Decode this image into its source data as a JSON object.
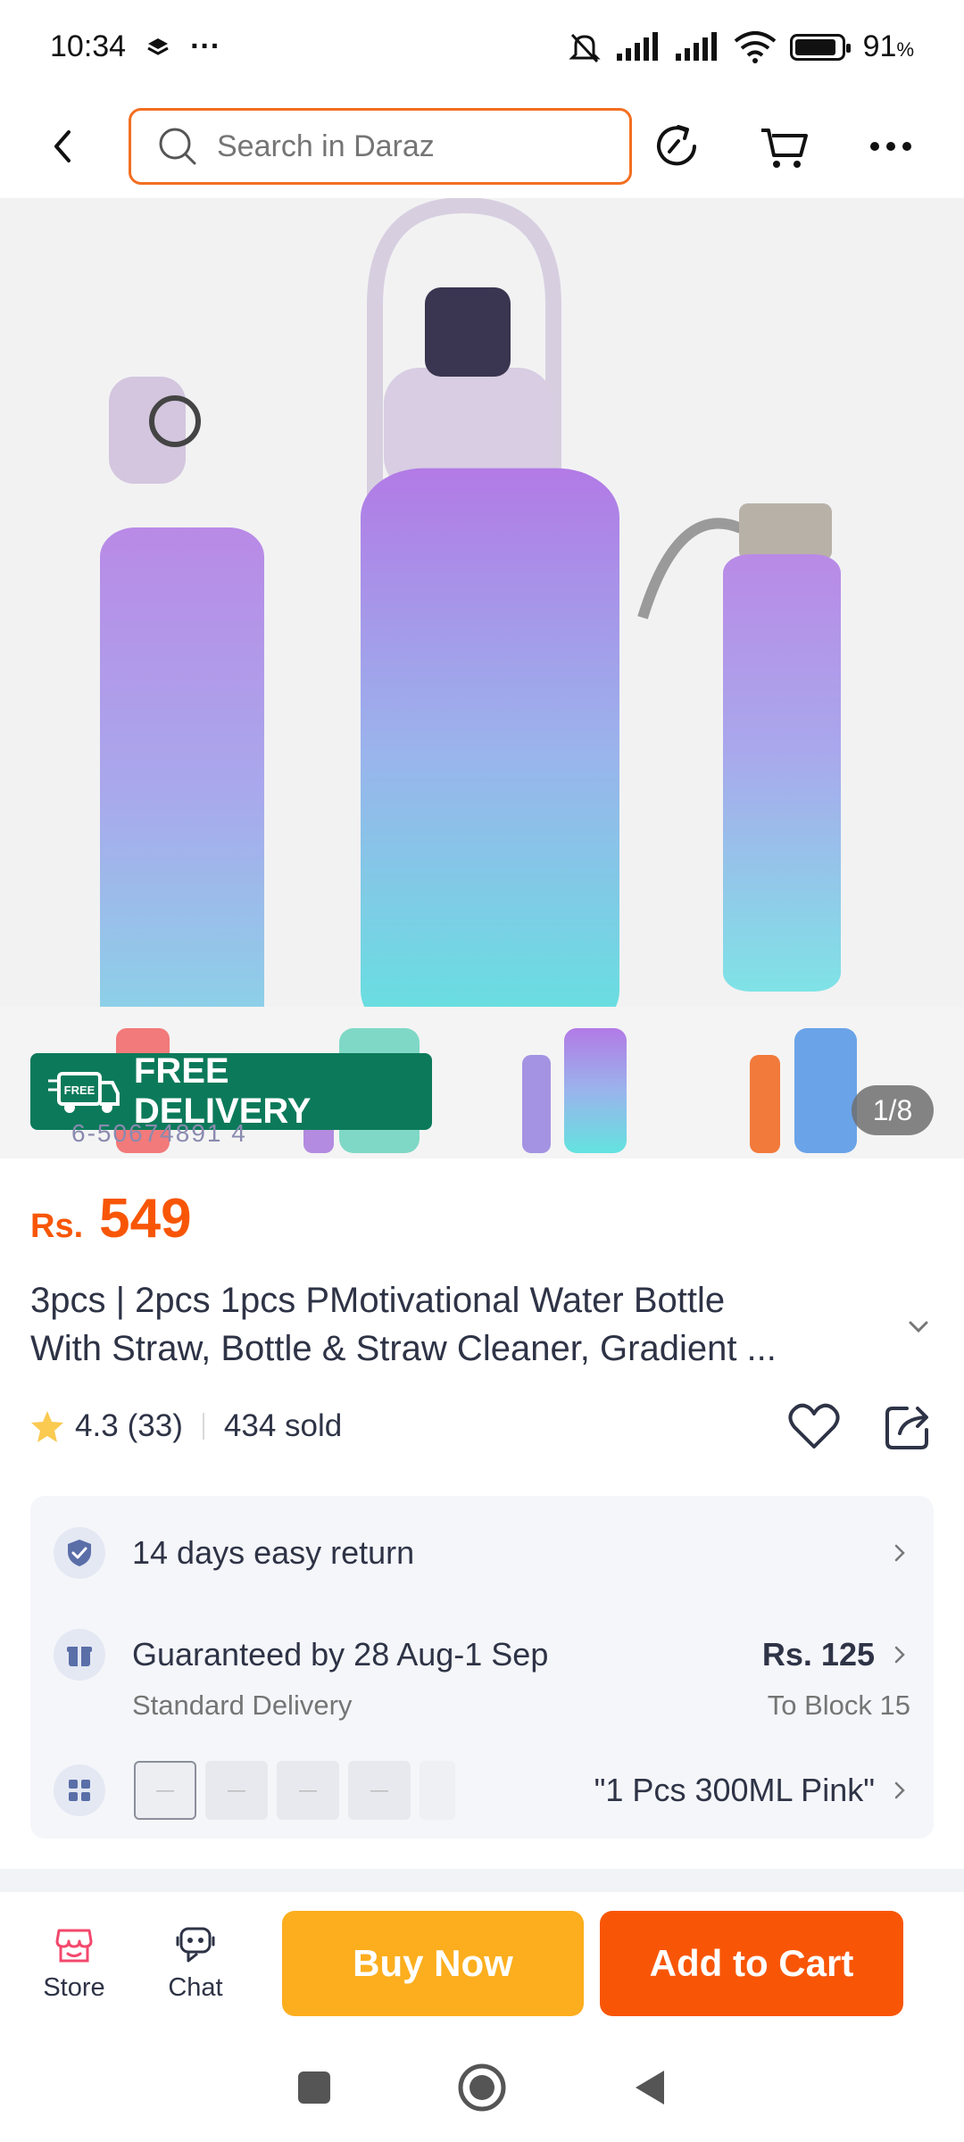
{
  "status_bar": {
    "time": "10:34",
    "more": "···",
    "battery_level_percent": 91,
    "battery_text": "91",
    "battery_unit": "%"
  },
  "top_nav": {
    "search_placeholder": "Search in Daraz",
    "accent_color": "#f36f21"
  },
  "gallery": {
    "free_delivery_label": "FREE DELIVERY",
    "truck_text": "FREE",
    "sku_text": "6-50674891 4",
    "page_indicator": "1/8"
  },
  "product": {
    "price_currency": "Rs.",
    "price_amount": "549",
    "title_line1": "3pcs | 2pcs 1pcs PMotivational Water Bottle",
    "title_line2": "With Straw, Bottle & Straw Cleaner, Gradient ...",
    "rating": "4.3",
    "rating_count": "(33)",
    "sold": "434 sold"
  },
  "info_card": {
    "return_label": "14 days easy return",
    "delivery_label": "Guaranteed by 28 Aug-1 Sep",
    "delivery_sub": "Standard Delivery",
    "delivery_price": "Rs. 125",
    "delivery_location": "To Block 15",
    "variant_selected": "\"1 Pcs 300ML Pink\""
  },
  "bottom_bar": {
    "store_label": "Store",
    "chat_label": "Chat",
    "buy_now_label": "Buy Now",
    "add_to_cart_label": "Add to Cart",
    "buy_color": "#fcae1e",
    "cart_color": "#f85606"
  },
  "icons": [
    "back-arrow-icon",
    "search-icon",
    "share-refresh-icon",
    "cart-icon",
    "more-icon",
    "star-icon",
    "heart-icon",
    "share-icon",
    "shield-check-icon",
    "gift-icon",
    "grid-icon",
    "store-icon",
    "chat-icon"
  ]
}
